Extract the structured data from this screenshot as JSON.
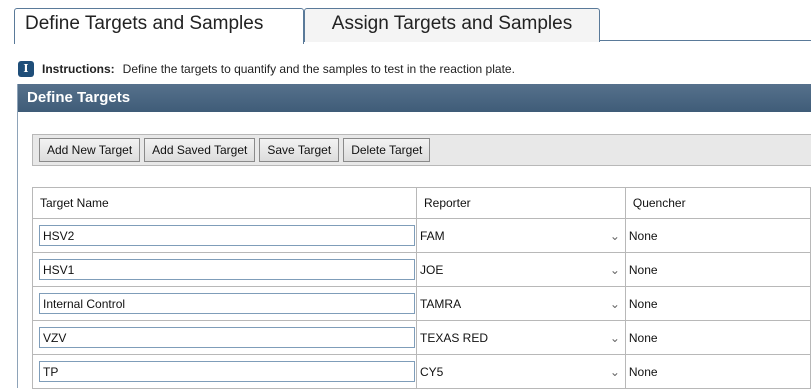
{
  "tabs": [
    {
      "label": "Define Targets and Samples",
      "active": true
    },
    {
      "label": "Assign Targets and Samples",
      "active": false
    }
  ],
  "instructions": {
    "icon": "info-icon",
    "label": "Instructions:",
    "text": "Define the targets to quantify and the samples to test in the reaction plate."
  },
  "panel": {
    "title": "Define Targets"
  },
  "toolbar": {
    "add_new": "Add New Target",
    "add_saved": "Add Saved Target",
    "save": "Save Target",
    "delete": "Delete Target"
  },
  "table": {
    "headers": [
      "Target Name",
      "Reporter",
      "Quencher"
    ],
    "rows": [
      {
        "name": "HSV2",
        "reporter": "FAM",
        "quencher": "None"
      },
      {
        "name": "HSV1",
        "reporter": "JOE",
        "quencher": "None"
      },
      {
        "name": "Internal Control",
        "reporter": "TAMRA",
        "quencher": "None"
      },
      {
        "name": "VZV",
        "reporter": "TEXAS RED",
        "quencher": "None"
      },
      {
        "name": "TP",
        "reporter": "CY5",
        "quencher": "None"
      }
    ]
  },
  "colors": {
    "header_bar": "#3f5c78",
    "tab_border": "#5a7a99",
    "instr_icon": "#1f4e79"
  }
}
